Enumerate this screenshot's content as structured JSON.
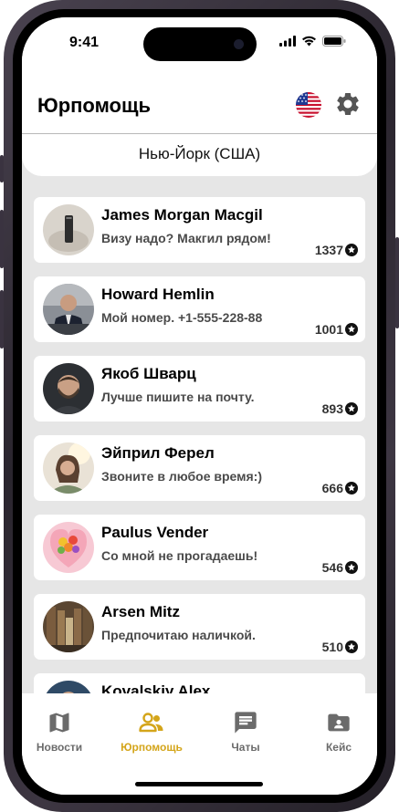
{
  "status": {
    "time": "9:41"
  },
  "header": {
    "title": "Юрпомощь",
    "city": "Нью-Йорк (США)"
  },
  "lawyers": [
    {
      "name": "James Morgan Macgil",
      "message": "Визу надо? Макгил рядом!",
      "rating": "1337",
      "avatar": "phone-photo"
    },
    {
      "name": "Howard Hemlin",
      "message": "Мой номер. +1-555-228-88",
      "rating": "1001",
      "avatar": "man-in-suit-photo"
    },
    {
      "name": "Якоб Шварц",
      "message": "Лучше пишите на почту.",
      "rating": "893",
      "avatar": "bearded-man-photo"
    },
    {
      "name": "Эйприл Ферел",
      "message": "Звоните в любое время:)",
      "rating": "666",
      "avatar": "woman-photo"
    },
    {
      "name": "Paulus Vender",
      "message": "Со мной не прогадаешь!",
      "rating": "546",
      "avatar": "flowers-photo"
    },
    {
      "name": "Arsen Mitz",
      "message": "Предпочитаю наличкой.",
      "rating": "510",
      "avatar": "library-photo"
    },
    {
      "name": "Kovalskiy Alex",
      "message": "",
      "rating": "",
      "avatar": "portrait-photo"
    }
  ],
  "tabs": [
    {
      "label": "Новости",
      "icon": "map-icon",
      "active": false
    },
    {
      "label": "Юрпомощь",
      "icon": "people-icon",
      "active": true
    },
    {
      "label": "Чаты",
      "icon": "chat-icon",
      "active": false
    },
    {
      "label": "Кейс",
      "icon": "folder-icon",
      "active": false
    }
  ],
  "colors": {
    "accent": "#d4a51a",
    "background": "#e6e6e6",
    "tab_inactive": "#6b6b6b"
  }
}
